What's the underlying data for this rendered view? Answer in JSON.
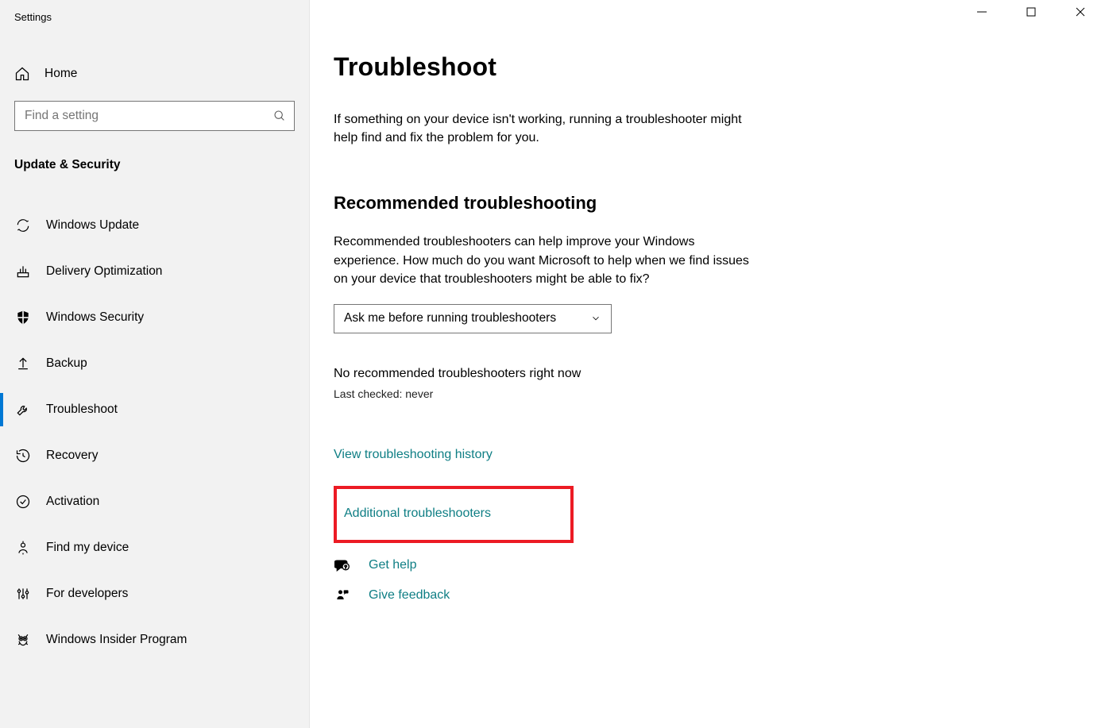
{
  "window": {
    "title": "Settings"
  },
  "sidebar": {
    "home_label": "Home",
    "search_placeholder": "Find a setting",
    "category": "Update & Security",
    "items": [
      {
        "label": "Windows Update",
        "icon": "sync-icon"
      },
      {
        "label": "Delivery Optimization",
        "icon": "network-icon"
      },
      {
        "label": "Windows Security",
        "icon": "shield-icon"
      },
      {
        "label": "Backup",
        "icon": "upload-icon"
      },
      {
        "label": "Troubleshoot",
        "icon": "wrench-icon",
        "active": true
      },
      {
        "label": "Recovery",
        "icon": "clock-icon"
      },
      {
        "label": "Activation",
        "icon": "check-circle-icon"
      },
      {
        "label": "Find my device",
        "icon": "person-pin-icon"
      },
      {
        "label": "For developers",
        "icon": "sliders-icon"
      },
      {
        "label": "Windows Insider Program",
        "icon": "bug-icon"
      }
    ]
  },
  "main": {
    "title": "Troubleshoot",
    "description": "If something on your device isn't working, running a troubleshooter might help find and fix the problem for you.",
    "section_title": "Recommended troubleshooting",
    "section_description": "Recommended troubleshooters can help improve your Windows experience. How much do you want Microsoft to help when we find issues on your device that troubleshooters might be able to fix?",
    "dropdown_value": "Ask me before running troubleshooters",
    "status": "No recommended troubleshooters right now",
    "status_sub": "Last checked: never",
    "links": {
      "history": "View troubleshooting history",
      "additional": "Additional troubleshooters",
      "help": "Get help",
      "feedback": "Give feedback"
    }
  }
}
